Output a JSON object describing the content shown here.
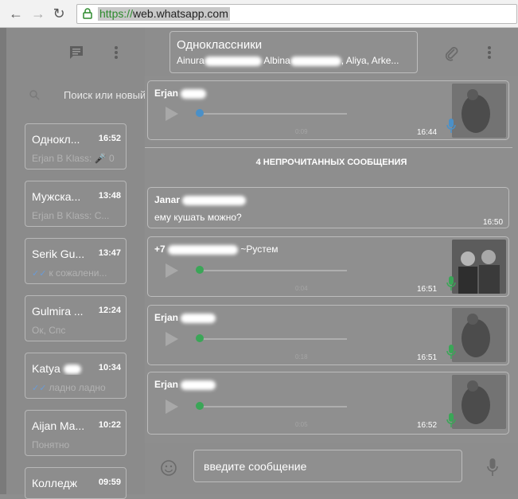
{
  "browser": {
    "url_scheme": "https://",
    "url_host": "web.whatsapp.com"
  },
  "sidebar": {
    "search_placeholder": "Поиск или новый",
    "chats": [
      {
        "name": "Однокл...",
        "time": "16:52",
        "preview": "Erjan B Klass: 🎤 0",
        "ticks": ""
      },
      {
        "name": "Мужска...",
        "time": "13:48",
        "preview": "Erjan B Klass: С...",
        "ticks": ""
      },
      {
        "name": "Serik Gu...",
        "time": "13:47",
        "preview": "к сожалени...",
        "ticks": "✓✓"
      },
      {
        "name": "Gulmira ...",
        "time": "12:24",
        "preview": "Ок, Спс",
        "ticks": ""
      },
      {
        "name": "Katya",
        "time": "10:34",
        "preview": "ладно ладно",
        "ticks": "✓✓"
      },
      {
        "name": "Aijan Ma...",
        "time": "10:22",
        "preview": "Понятно",
        "ticks": ""
      },
      {
        "name": "Колледж",
        "time": "09:59",
        "preview": "",
        "ticks": ""
      }
    ]
  },
  "conversation": {
    "title": "Одноклассники",
    "members": {
      "m1": "Ainura",
      "m2": "Albina",
      "m3": ", Aliya, Arke..."
    },
    "unread_divider": "4 НЕПРОЧИТАННЫХ СООБЩЕНИЯ",
    "messages": [
      {
        "sender": "Erjan",
        "duration": "0:09",
        "time": "16:44"
      },
      {
        "sender": "Janar",
        "text": "ему кушать можно?",
        "time": "16:50"
      },
      {
        "sender_prefix": "+7",
        "sender_suffix": "~Рустем",
        "duration": "0:04",
        "time": "16:51"
      },
      {
        "sender": "Erjan",
        "duration": "0:18",
        "time": "16:51"
      },
      {
        "sender": "Erjan",
        "duration": "0:05",
        "time": "16:52"
      }
    ]
  },
  "composer": {
    "placeholder": "введите сообщение"
  },
  "colors": {
    "accent_green": "#3aa657",
    "accent_blue": "#4a90c8",
    "tick_blue": "#6a9bd6"
  }
}
